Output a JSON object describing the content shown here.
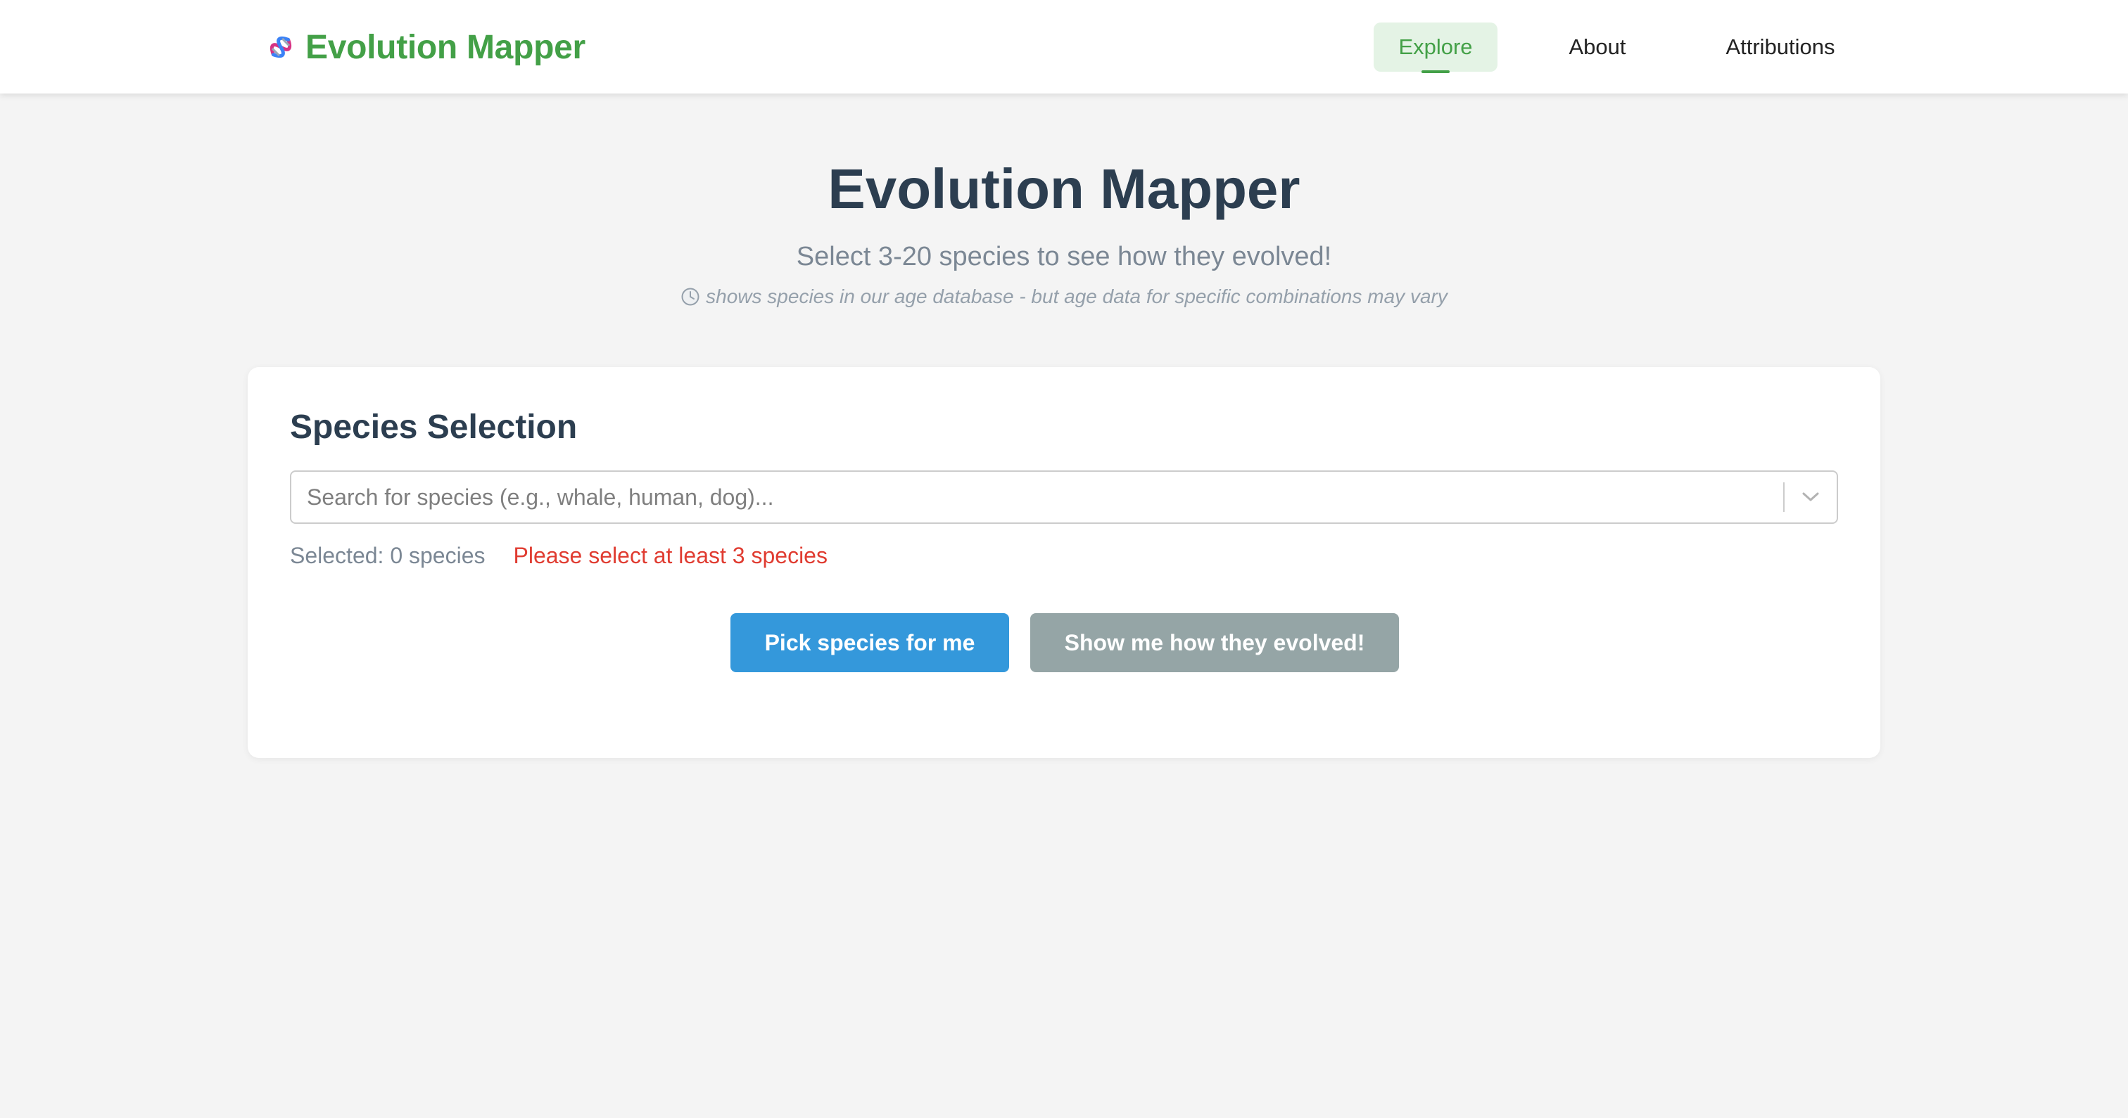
{
  "colors": {
    "brand": "#43a047",
    "primary": "#3498db",
    "disabled": "#95a5a6",
    "warning": "#e03c31",
    "heading": "#2c3e50"
  },
  "nav": {
    "brand_icon": "dna-icon",
    "brand_text": "Evolution Mapper",
    "items": [
      {
        "label": "Explore",
        "active": true
      },
      {
        "label": "About",
        "active": false
      },
      {
        "label": "Attributions",
        "active": false
      }
    ]
  },
  "hero": {
    "title": "Evolution Mapper",
    "subtitle": "Select 3-20 species to see how they evolved!",
    "note_icon": "clock-icon",
    "note": "shows species in our age database - but age data for specific combinations may vary"
  },
  "selection": {
    "title": "Species Selection",
    "search_placeholder": "Search for species (e.g., whale, human, dog)...",
    "search_value": "",
    "dropdown_icon": "chevron-down-icon",
    "selected_text": "Selected: 0 species",
    "warning": "Please select at least 3 species",
    "pick_button": "Pick species for me",
    "show_button": "Show me how they evolved!"
  }
}
